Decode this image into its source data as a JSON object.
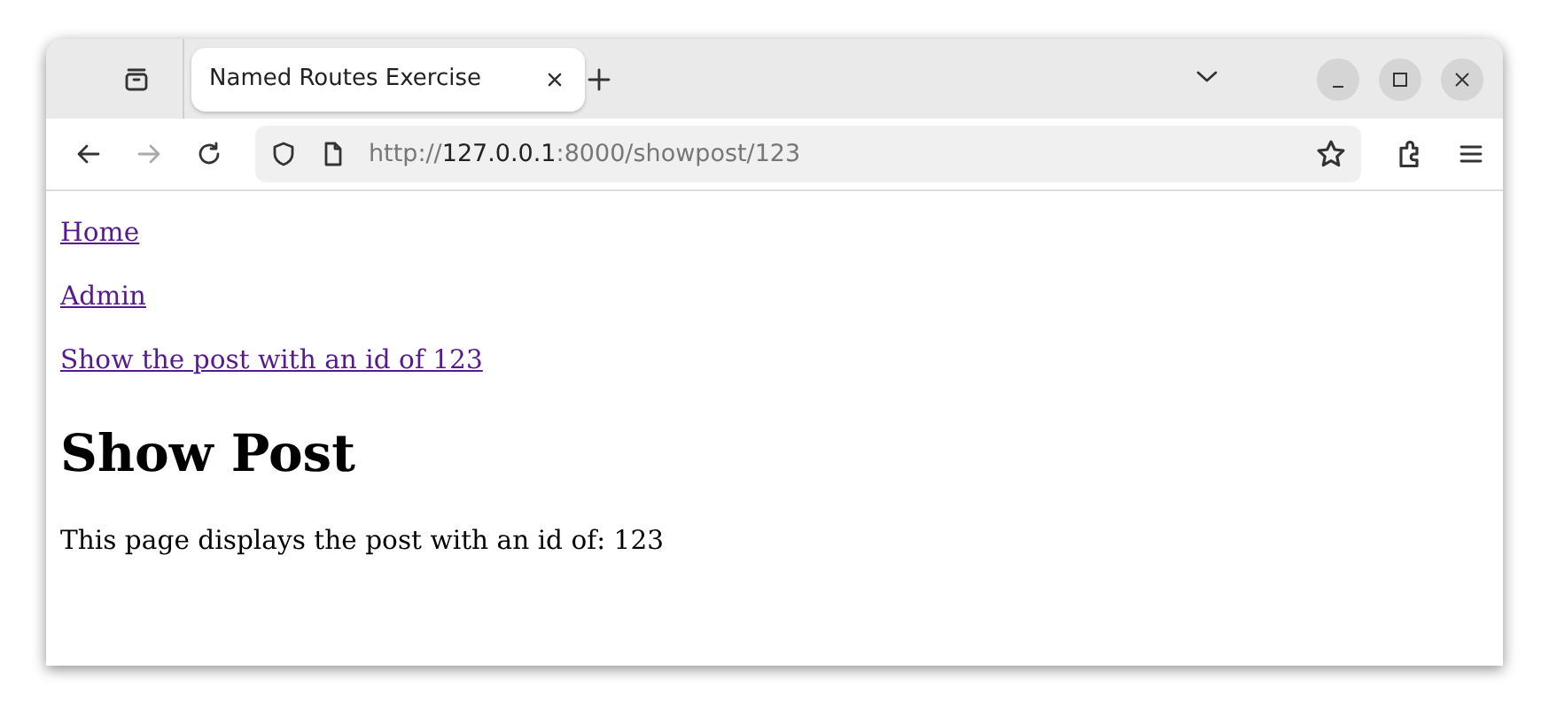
{
  "window": {
    "tabs": [
      {
        "title": "Named Routes Exercise",
        "selected": true
      }
    ]
  },
  "address_bar": {
    "scheme": "http://",
    "host": "127.0.0.1",
    "path": ":8000/showpost/123"
  },
  "page": {
    "links": [
      "Home",
      "Admin",
      "Show the post with an id of 123"
    ],
    "heading": "Show Post",
    "paragraph": "This page displays the post with an id of: 123"
  }
}
